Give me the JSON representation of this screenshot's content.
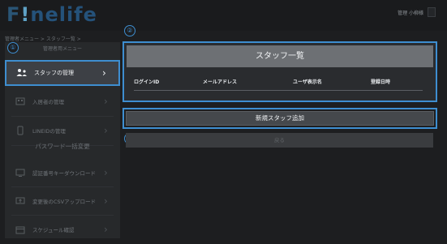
{
  "header": {
    "logo_prefix": "F",
    "logo_bang": "!",
    "logo_suffix": "nelife",
    "user_text": "管理 小柳様"
  },
  "breadcrumb": "管理者メニュー > スタッフ一覧 >",
  "sidebar": {
    "title": "管理者用メニュー",
    "items": [
      {
        "label": "スタッフの管理",
        "icon": "staff-icon"
      },
      {
        "label": "入居者の管理",
        "icon": "resident-icon"
      },
      {
        "label": "LINEIDの管理",
        "icon": "phone-icon"
      }
    ],
    "section": "パスワード一括変更",
    "sub_items": [
      {
        "label": "認証番号キーダウンロード",
        "icon": "monitor-icon"
      },
      {
        "label": "変更後のCSVアップロード",
        "icon": "upload-icon"
      },
      {
        "label": "スケジュール確認",
        "icon": "calendar-icon"
      }
    ]
  },
  "annotations": [
    "①",
    "②",
    "③"
  ],
  "panel": {
    "title": "スタッフ一覧",
    "columns": [
      "ログインID",
      "メールアドレス",
      "ユーザ表示名",
      "登録日時"
    ]
  },
  "buttons": {
    "add_staff": "新規スタッフ追加",
    "back": "戻る"
  },
  "colors": {
    "accent": "#3e8ed0",
    "background": "#1d1e20",
    "header_bar": "#6d7074"
  }
}
